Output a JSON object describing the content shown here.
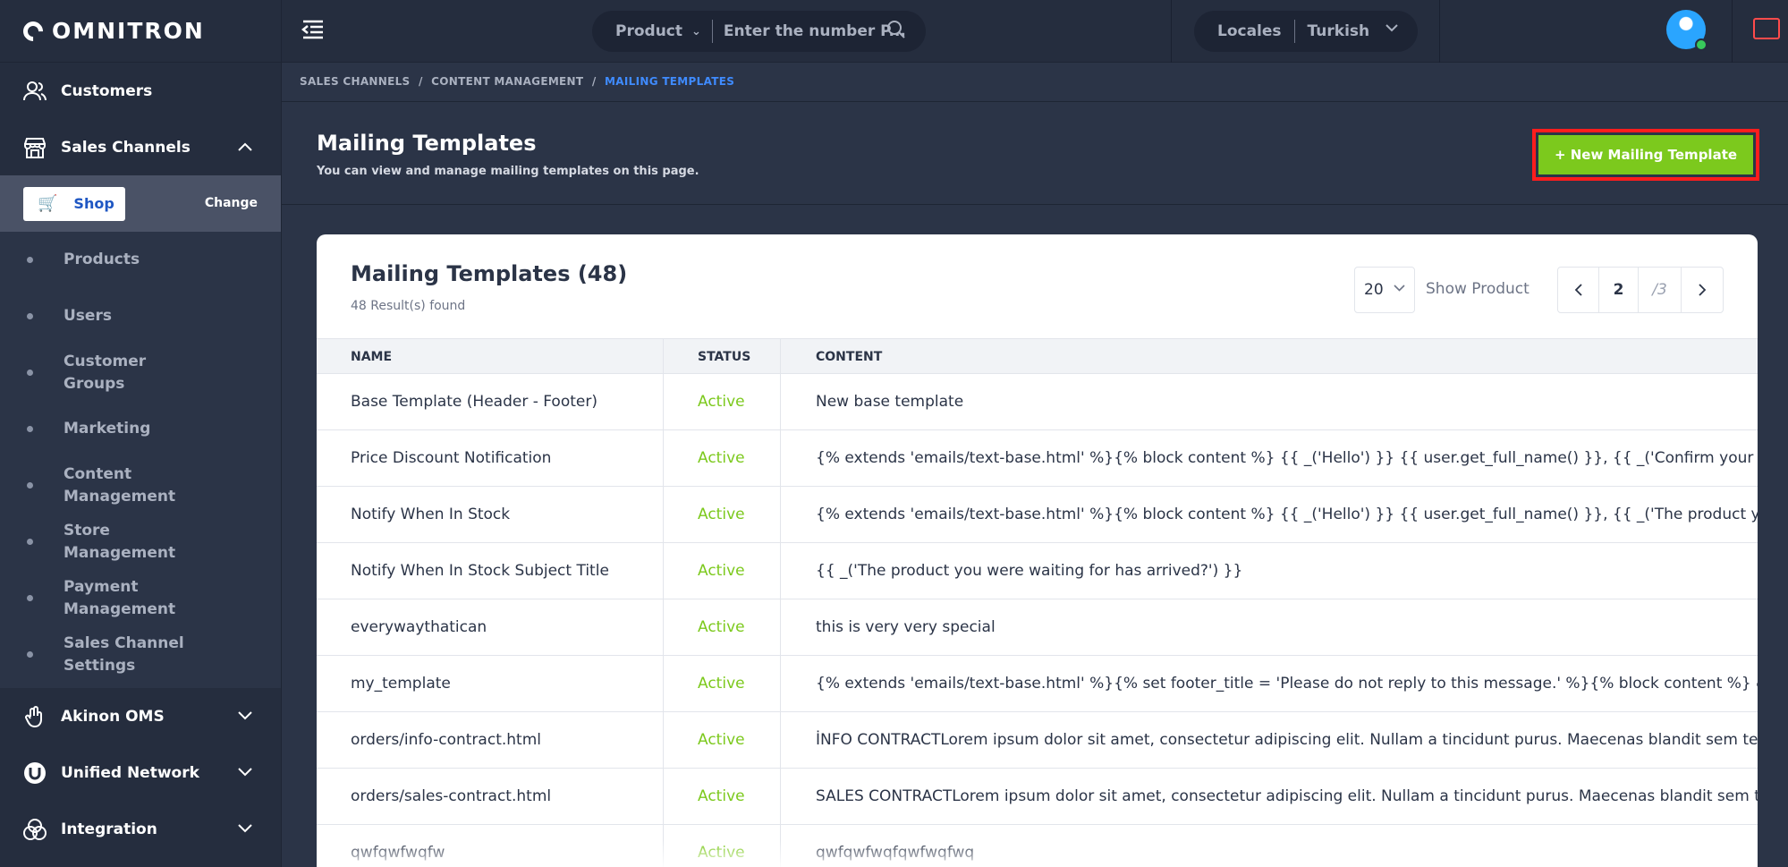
{
  "app": {
    "logo": "OMNITRON"
  },
  "topbar": {
    "search_scope": "Product",
    "search_placeholder": "Enter the number P...",
    "locale_label": "Locales",
    "locale_value": "Turkish"
  },
  "sidebar": {
    "customers": "Customers",
    "sales_channels": "Sales Channels",
    "shop_label": "Shop",
    "change_label": "Change",
    "sub_items": [
      "Products",
      "Users",
      "Customer Groups",
      "Marketing",
      "Content Management",
      "Store Management",
      "Payment Management",
      "Sales Channel Settings"
    ],
    "akinon_oms": "Akinon OMS",
    "unified_network": "Unified Network",
    "integration": "Integration"
  },
  "breadcrumb": {
    "part1": "SALES CHANNELS",
    "part2": "CONTENT MANAGEMENT",
    "part3": "MAILING TEMPLATES",
    "sep": "/"
  },
  "page": {
    "title": "Mailing Templates",
    "subtitle": "You can view and manage mailing templates on this page.",
    "new_button": "+ New Mailing Template"
  },
  "card": {
    "title": "Mailing Templates (48)",
    "result_count": "48 Result(s) found",
    "page_size": "20",
    "show_label": "Show Product",
    "current_page": "2",
    "total_pages": "/3"
  },
  "table": {
    "columns": [
      "NAME",
      "STATUS",
      "CONTENT"
    ],
    "rows": [
      {
        "name": "Base Template (Header - Footer)",
        "status": "Active",
        "content": "New base template"
      },
      {
        "name": "Price Discount Notification",
        "status": "Active",
        "content": "{% extends 'emails/text-base.html' %}{% block content %} {{ _('Hello') }} {{ user.get_full_name() }}, {{ _('Confirm your email address!') }} &nbsp;"
      },
      {
        "name": "Notify When In Stock",
        "status": "Active",
        "content": "{% extends 'emails/text-base.html' %}{% block content %} {{ _('Hello') }} {{ user.get_full_name() }}, {{ _('The product you were waiting for has a"
      },
      {
        "name": "Notify When In Stock Subject Title",
        "status": "Active",
        "content": "{{ _('The product you were waiting for has arrived?') }}"
      },
      {
        "name": "everywaythatican",
        "status": "Active",
        "content": "this is very very special"
      },
      {
        "name": "my_template",
        "status": "Active",
        "content": "{% extends 'emails/text-base.html' %}{% set footer_title = 'Please do not reply to this message.' %}{% block content %} &nbsp; {{ _('Hello', did"
      },
      {
        "name": "orders/info-contract.html",
        "status": "Active",
        "content": "İNFO CONTRACTLorem ipsum dolor sit amet, consectetur adipiscing elit. Nullam a tincidunt purus. Maecenas blandit sem tellus, ut elementu"
      },
      {
        "name": "orders/sales-contract.html",
        "status": "Active",
        "content": "SALES CONTRACTLorem ipsum dolor sit amet, consectetur adipiscing elit. Nullam a tincidunt purus. Maecenas blandit sem tellus, ut elemen"
      },
      {
        "name": "qwfqwfwqfw",
        "status": "Active",
        "content": "qwfqwfwqfqwfwqfwq"
      }
    ]
  },
  "colors": {
    "accent_green": "#7cc91d",
    "breadcrumb_active": "#3f8bff",
    "highlight_border": "#ff1d1d",
    "sidebar_bg": "#252d3e",
    "page_bg": "#2b3447"
  }
}
